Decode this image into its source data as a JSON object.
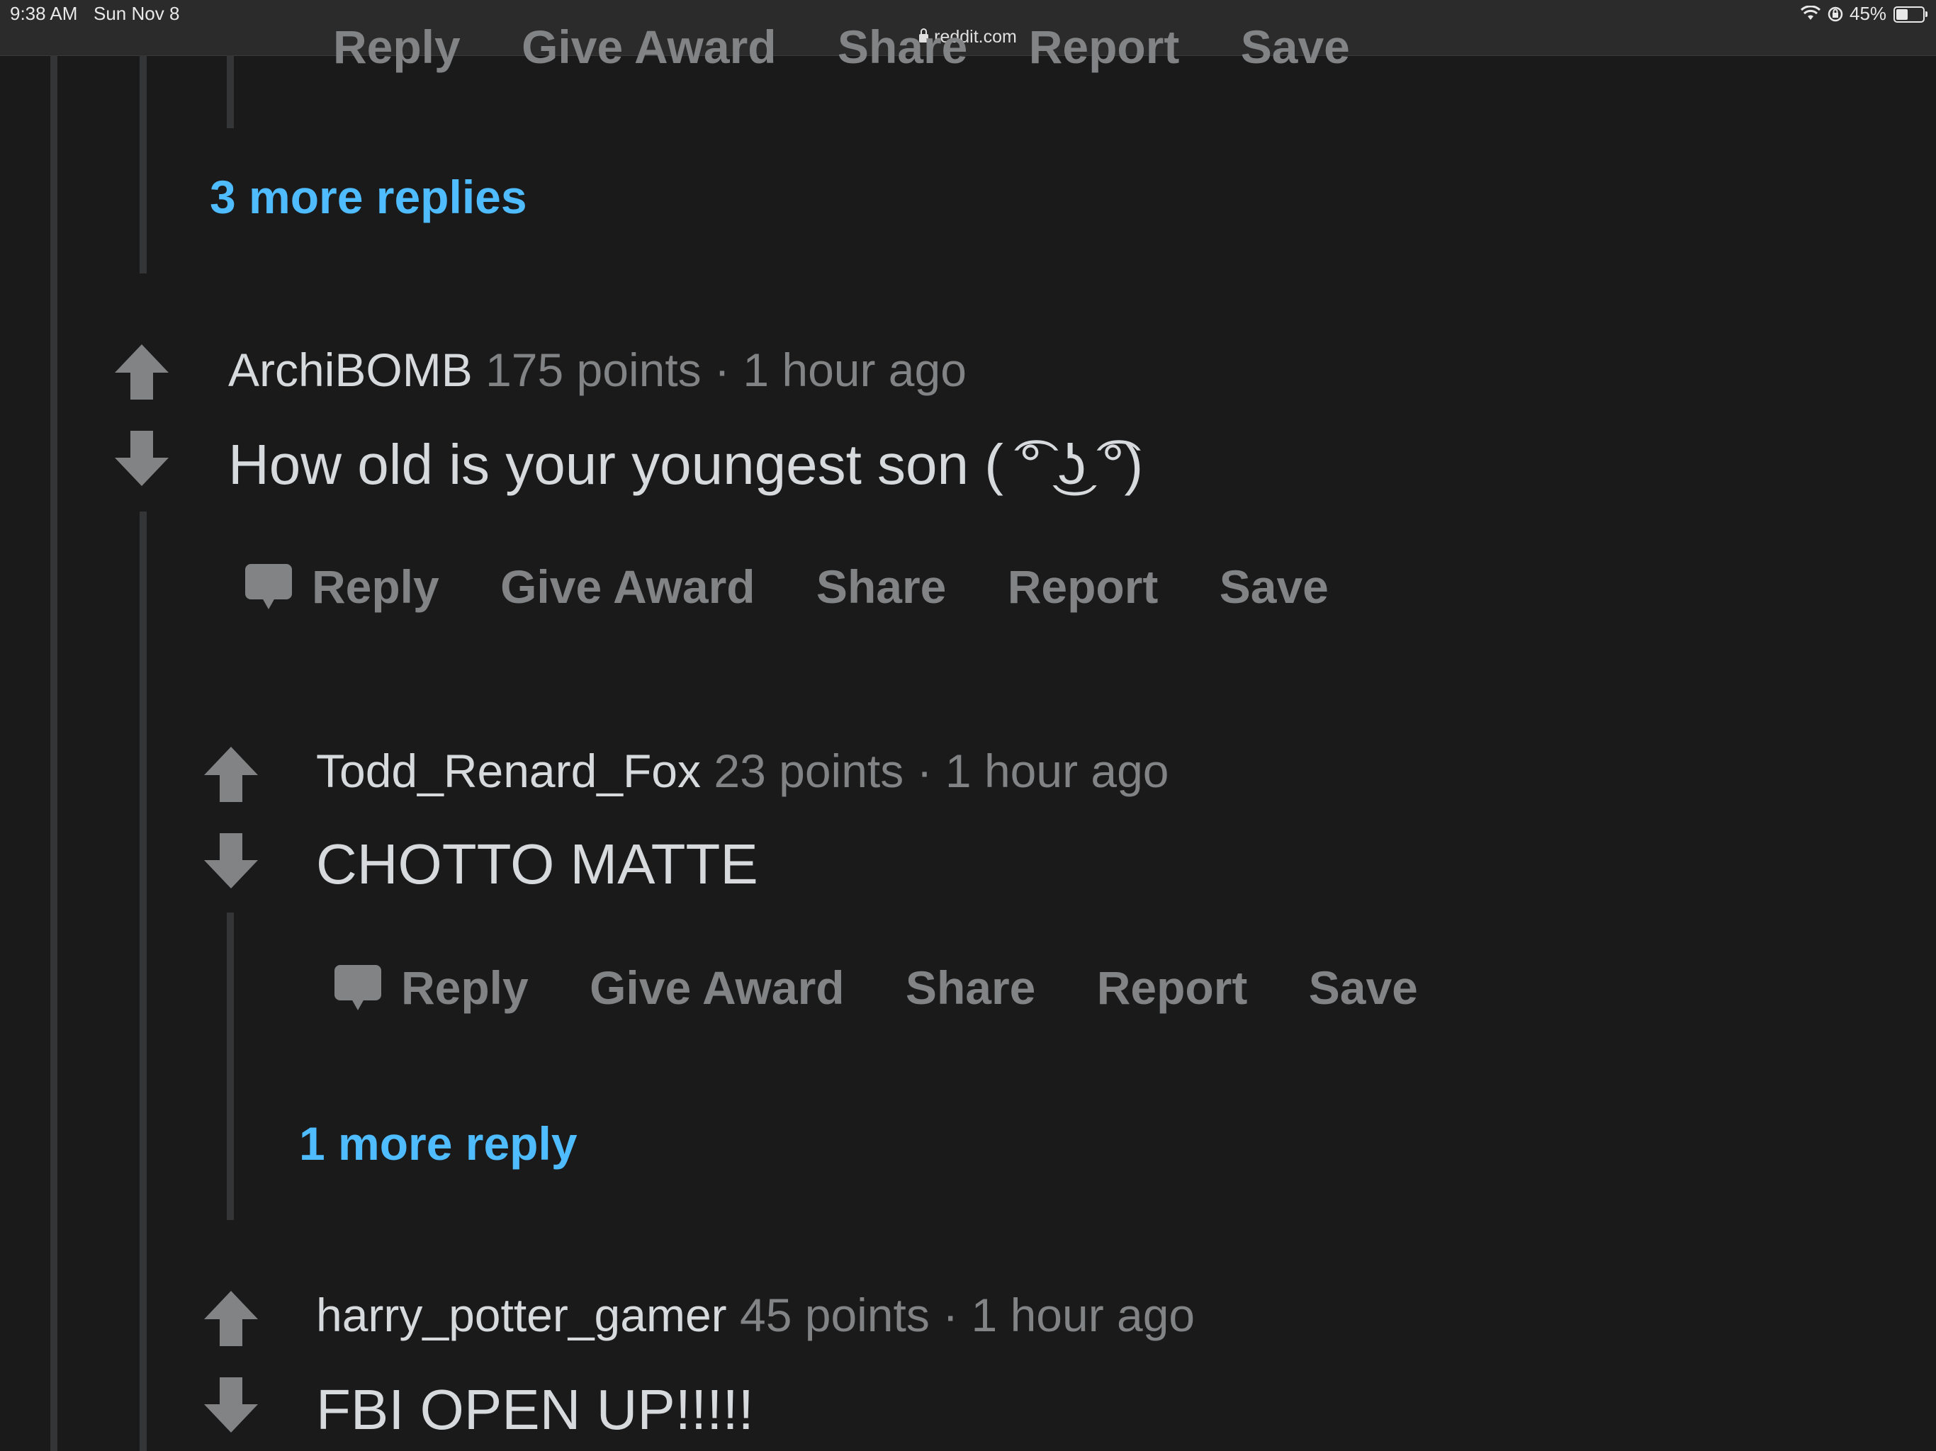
{
  "status_bar": {
    "time": "9:38 AM",
    "date": "Sun Nov 8",
    "url": "reddit.com",
    "battery": "45%",
    "battery_level": 0.45
  },
  "top_actions": [
    "Reply",
    "Give Award",
    "Share",
    "Report",
    "Save"
  ],
  "more_replies_top": "3 more replies",
  "comments": [
    {
      "author": "ArchiBOMB",
      "points": "175 points",
      "separator": "·",
      "time": "1 hour ago",
      "text": "How old is your youngest son ( ͡° ͜ʖ ͡°)",
      "actions": [
        "Reply",
        "Give Award",
        "Share",
        "Report",
        "Save"
      ]
    },
    {
      "author": "Todd_Renard_Fox",
      "points": "23 points",
      "separator": "·",
      "time": "1 hour ago",
      "text": "CHOTTO MATTE",
      "actions": [
        "Reply",
        "Give Award",
        "Share",
        "Report",
        "Save"
      ],
      "more": "1 more reply"
    },
    {
      "author": "harry_potter_gamer",
      "points": "45 points",
      "separator": "·",
      "time": "1 hour ago",
      "text": "FBI OPEN UP!!!!!"
    }
  ],
  "colors": {
    "background": "#1a1a1b",
    "text": "#d7dadc",
    "muted": "#818384",
    "link": "#4fbcff",
    "thread_line": "#343536"
  }
}
